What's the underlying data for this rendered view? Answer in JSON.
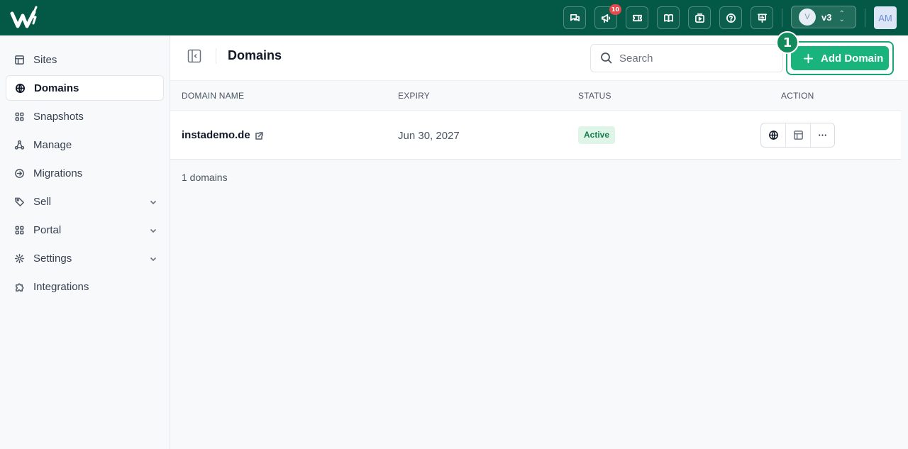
{
  "topbar": {
    "notification_count": "10",
    "version_avatar": "V",
    "version_label": "v3",
    "user_initials": "AM",
    "colors": {
      "background": "#035946",
      "badge": "#e5484d"
    },
    "icons": [
      "chat-icon",
      "megaphone-icon",
      "ticket-icon",
      "book-icon",
      "video-icon",
      "help-icon",
      "presentation-icon"
    ]
  },
  "sidebar": {
    "items": [
      {
        "label": "Sites",
        "icon": "layout-icon"
      },
      {
        "label": "Domains",
        "icon": "globe-icon",
        "active": true
      },
      {
        "label": "Snapshots",
        "icon": "grid-icon"
      },
      {
        "label": "Manage",
        "icon": "hierarchy-icon"
      },
      {
        "label": "Migrations",
        "icon": "arrow-circle-icon"
      },
      {
        "label": "Sell",
        "icon": "tag-icon",
        "expandable": true
      },
      {
        "label": "Portal",
        "icon": "grid-icon",
        "expandable": true
      },
      {
        "label": "Settings",
        "icon": "gear-icon",
        "expandable": true
      },
      {
        "label": "Integrations",
        "icon": "puzzle-icon"
      }
    ]
  },
  "header": {
    "title": "Domains",
    "search_placeholder": "Search",
    "add_button_label": "Add Domain",
    "step_badge": "1",
    "accent_color": "#18b47b"
  },
  "table": {
    "columns": [
      "DOMAIN NAME",
      "EXPIRY",
      "STATUS",
      "ACTION"
    ],
    "rows": [
      {
        "domain": "instademo.de",
        "expiry": "Jun 30, 2027",
        "status": "Active"
      }
    ],
    "count_label": "1 domains"
  }
}
